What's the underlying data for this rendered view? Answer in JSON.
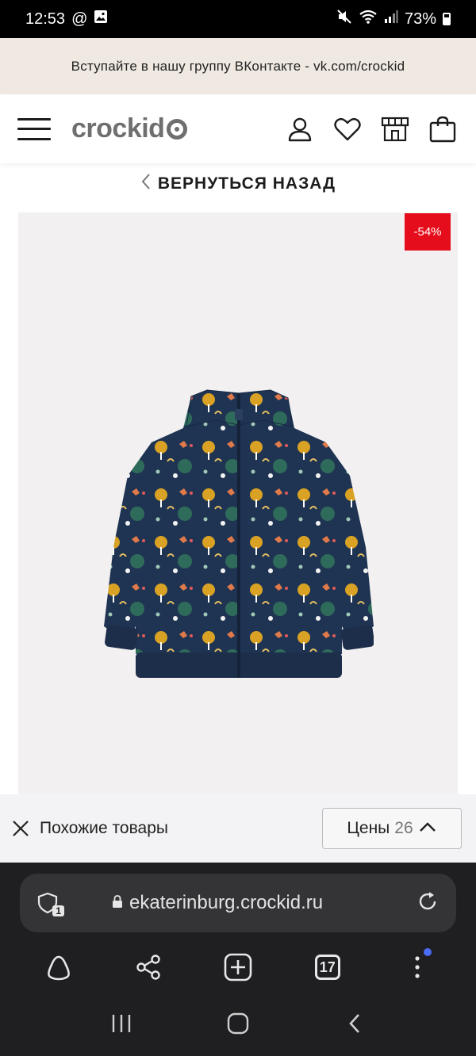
{
  "status_bar": {
    "time": "12:53",
    "at_symbol": "@",
    "battery": "73%",
    "icons": [
      "image-icon",
      "mute-icon",
      "wifi-icon",
      "signal-icon",
      "battery-icon"
    ]
  },
  "promo": {
    "text": "Вступайте в нашу группу ВКонтакте - vk.com/crockid"
  },
  "header": {
    "logo_text": "crockid",
    "icons": [
      "menu-icon",
      "user-icon",
      "heart-icon",
      "store-icon",
      "bag-icon"
    ]
  },
  "back_link": {
    "label": "ВЕРНУТЬСЯ НАЗАД"
  },
  "product": {
    "discount": "-54%",
    "colors": {
      "background": "#f2f0f1",
      "jacket": "#1f3452",
      "badge": "#e50d1c"
    }
  },
  "similar_panel": {
    "label": "Похожие товары",
    "price_label": "Цены",
    "price_count": "26"
  },
  "browser": {
    "url": "ekaterinburg.crockid.ru",
    "tabs_count": "17",
    "shield_count": "1"
  },
  "colors": {
    "promo_bg": "#efe9e1",
    "browser_bg": "#1f1f21",
    "url_field_bg": "#343437",
    "accent_dot": "#4a6cf7"
  }
}
